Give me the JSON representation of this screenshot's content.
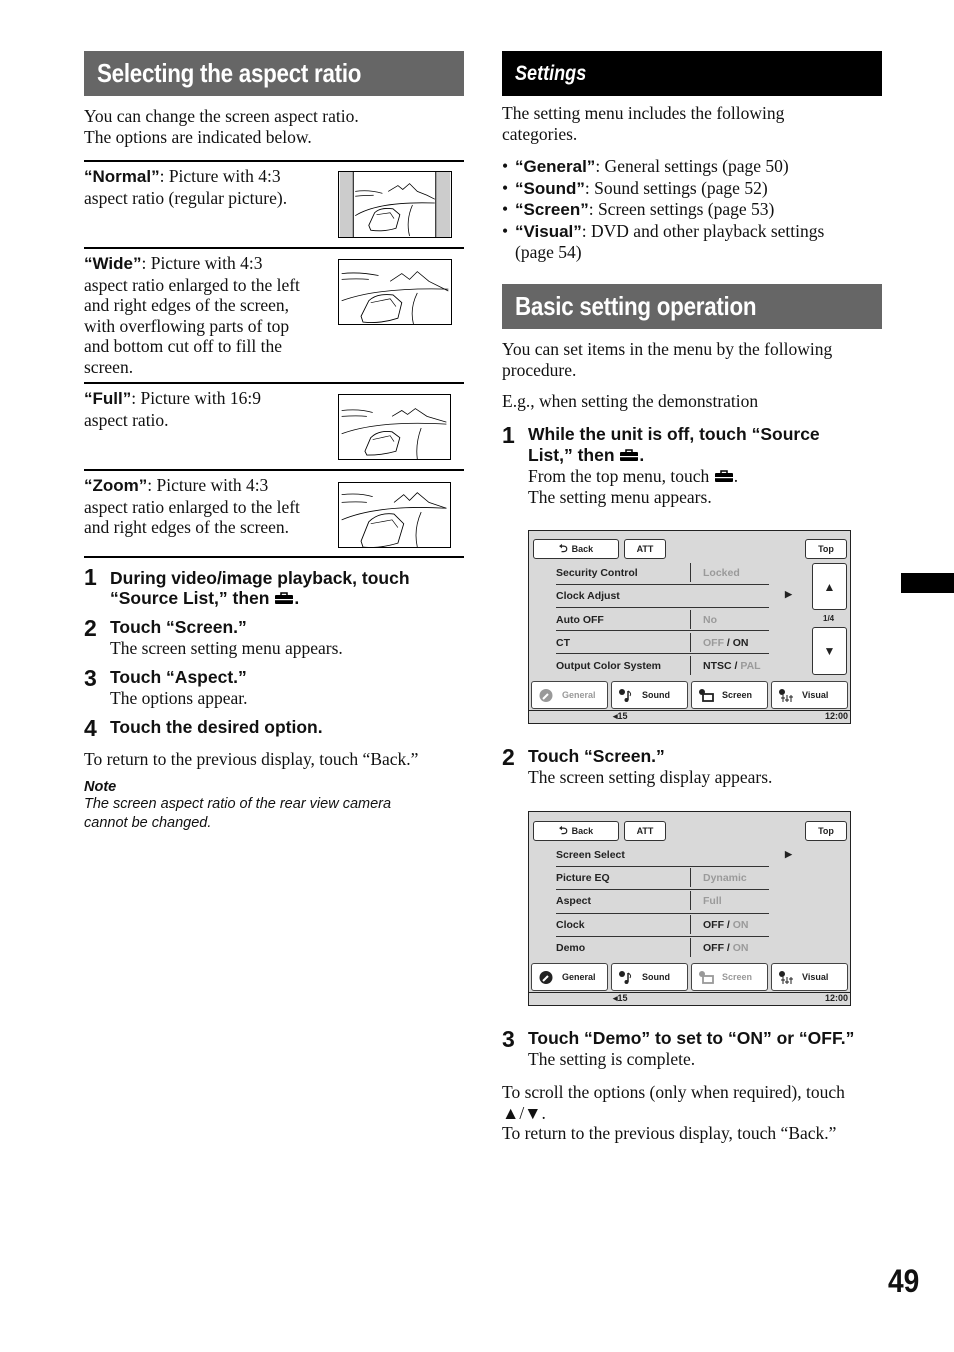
{
  "page_number": "49",
  "left": {
    "title": "Selecting the aspect ratio",
    "intro": [
      "You can change the screen aspect ratio.",
      "The options are indicated below."
    ],
    "options": [
      {
        "name": "“Normal”",
        "desc_lines": [
          ": Picture with 4:3",
          "aspect ratio (regular picture)."
        ],
        "illustration": "normal-aspect-illustration"
      },
      {
        "name": "“Wide”",
        "desc_lines": [
          ": Picture with 4:3",
          "aspect ratio enlarged to the left",
          "and right edges of the screen,",
          "with overflowing parts of top",
          "and bottom cut off to fill the",
          "screen."
        ],
        "illustration": "wide-aspect-illustration"
      },
      {
        "name": "“Full”",
        "desc_lines": [
          ": Picture with 16:9",
          "aspect ratio."
        ],
        "illustration": "full-aspect-illustration"
      },
      {
        "name": "“Zoom”",
        "desc_lines": [
          ": Picture with 4:3",
          "aspect ratio enlarged to the left",
          "and right edges of the screen."
        ],
        "illustration": "zoom-aspect-illustration"
      }
    ],
    "steps": [
      {
        "num": "1",
        "head_lines": [
          "During video/image playback, touch",
          "“Source List,” then"
        ],
        "head_suffix": "."
      },
      {
        "num": "2",
        "head": "Touch “Screen.”",
        "sub": "The screen setting menu appears."
      },
      {
        "num": "3",
        "head": "Touch “Aspect.”",
        "sub": "The options appear."
      },
      {
        "num": "4",
        "head": "Touch the desired option."
      }
    ],
    "return_text": "To return to the previous display, touch “Back.”",
    "note": {
      "title": "Note",
      "lines": [
        "The screen aspect ratio of the rear view camera",
        "cannot be changed."
      ]
    }
  },
  "right": {
    "settings": {
      "title": "Settings",
      "intro": [
        "The setting menu includes the following",
        "categories."
      ],
      "categories": [
        {
          "name": "“General”",
          "desc": ": General settings (page 50)"
        },
        {
          "name": "“Sound”",
          "desc": ": Sound settings (page 52)"
        },
        {
          "name": "“Screen”",
          "desc": ": Screen settings (page 53)"
        },
        {
          "name": "“Visual”",
          "desc": ": DVD and other playback settings",
          "desc2": "(page 54)"
        }
      ]
    },
    "basic": {
      "title": "Basic setting operation",
      "intro": [
        "You can set items in the menu by the following",
        "procedure."
      ],
      "example": "E.g., when setting the demonstration",
      "step1": {
        "num": "1",
        "head_lines": [
          "While the unit is off, touch “Source",
          "List,” then"
        ],
        "head_suffix": ".",
        "sub1_prefix": "From the top menu, touch",
        "sub1_suffix": ".",
        "sub2": "The setting menu appears."
      },
      "step2": {
        "num": "2",
        "head": "Touch “Screen.”",
        "sub": "The screen setting display appears."
      },
      "step3": {
        "num": "3",
        "head": "Touch “Demo” to set to “ON” or “OFF.”",
        "sub": "The setting is complete."
      },
      "scroll_text": "To scroll the options (only when required), touch",
      "scroll_symbols": "▲/▼.",
      "return_text": "To return to the previous display, touch “Back.”"
    }
  },
  "screen1": {
    "back": "Back",
    "att": "ATT",
    "top": "Top",
    "rows": [
      {
        "label": "Security Control",
        "value_parts": [
          {
            "t": "Locked",
            "dim": true
          }
        ],
        "has_value": true
      },
      {
        "label": "Clock Adjust",
        "value_parts": [],
        "has_value": false,
        "arrow": "▶"
      },
      {
        "label": "Auto OFF",
        "value_parts": [
          {
            "t": "No",
            "dim": true
          }
        ],
        "has_value": true
      },
      {
        "label": "CT",
        "value_parts": [
          {
            "t": "OFF",
            "dim": true
          },
          {
            "t": " / ON",
            "dim": false
          }
        ],
        "has_value": true
      },
      {
        "label": "Output Color System",
        "value_parts": [
          {
            "t": "NTSC / ",
            "dim": false
          },
          {
            "t": "PAL",
            "dim": true
          }
        ],
        "has_value": true
      }
    ],
    "page_indicator": "1/4",
    "up": "▲",
    "down": "▼",
    "tabs": [
      {
        "label": "General",
        "active": true
      },
      {
        "label": "Sound",
        "active": false
      },
      {
        "label": "Screen",
        "active": false
      },
      {
        "label": "Visual",
        "active": false
      }
    ],
    "volume": "15",
    "time": "12:00"
  },
  "screen2": {
    "back": "Back",
    "att": "ATT",
    "top": "Top",
    "rows": [
      {
        "label": "Screen Select",
        "value_parts": [],
        "has_value": false,
        "arrow": "▶"
      },
      {
        "label": "Picture EQ",
        "value_parts": [
          {
            "t": "Dynamic",
            "dim": true
          }
        ],
        "has_value": true
      },
      {
        "label": "Aspect",
        "value_parts": [
          {
            "t": "Full",
            "dim": true
          }
        ],
        "has_value": true
      },
      {
        "label": "Clock",
        "value_parts": [
          {
            "t": "OFF / ",
            "dim": false
          },
          {
            "t": "ON",
            "dim": true
          }
        ],
        "has_value": true
      },
      {
        "label": "Demo",
        "value_parts": [
          {
            "t": "OFF / ",
            "dim": false
          },
          {
            "t": "ON",
            "dim": true
          }
        ],
        "has_value": true
      }
    ],
    "tabs": [
      {
        "label": "General",
        "active": false
      },
      {
        "label": "Sound",
        "active": false
      },
      {
        "label": "Screen",
        "active": true
      },
      {
        "label": "Visual",
        "active": false
      }
    ],
    "volume": "15",
    "time": "12:00"
  }
}
